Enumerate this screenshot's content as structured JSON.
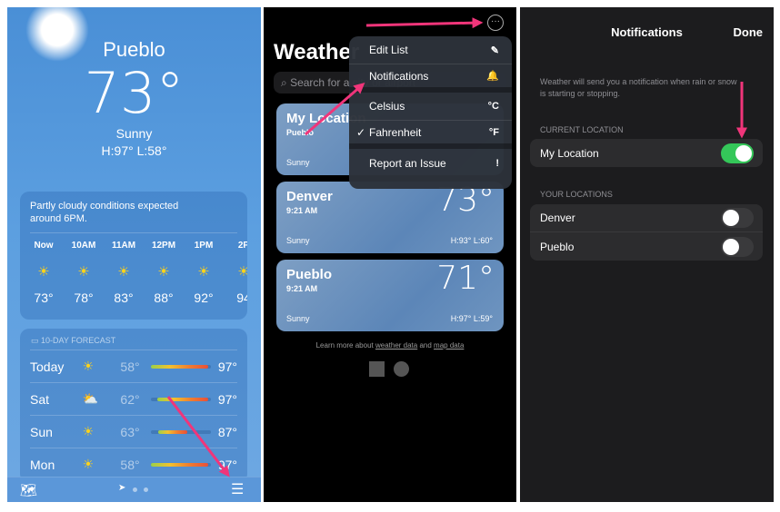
{
  "panel1": {
    "city": "Pueblo",
    "temp": "73°",
    "condition": "Sunny",
    "hilo": "H:97° L:58°",
    "summary": "Partly cloudy conditions expected around 6PM.",
    "hourly": [
      {
        "time": "Now",
        "temp": "73°"
      },
      {
        "time": "10AM",
        "temp": "78°"
      },
      {
        "time": "11AM",
        "temp": "83°"
      },
      {
        "time": "12PM",
        "temp": "88°"
      },
      {
        "time": "1PM",
        "temp": "92°"
      },
      {
        "time": "2P",
        "temp": "94"
      }
    ],
    "forecast_title": "10-DAY FORECAST",
    "days": [
      {
        "day": "Today",
        "icon": "sun",
        "low": "58°",
        "high": "97°"
      },
      {
        "day": "Sat",
        "icon": "partly-cloudy",
        "low": "62°",
        "high": "97°"
      },
      {
        "day": "Sun",
        "icon": "sun",
        "low": "63°",
        "high": "87°"
      },
      {
        "day": "Mon",
        "icon": "sun",
        "low": "58°",
        "high": "97°"
      }
    ]
  },
  "panel2": {
    "title": "Weather",
    "search_placeholder": "Search for a city or airport",
    "menu": [
      {
        "label": "Edit List",
        "icon": "✎"
      },
      {
        "label": "Notifications",
        "icon": "🔔"
      },
      {
        "label": "Celsius",
        "icon": "°C"
      },
      {
        "label": "Fahrenheit",
        "icon": "°F",
        "checked": "✓"
      },
      {
        "label": "Report an Issue",
        "icon": "!"
      }
    ],
    "locations": [
      {
        "name": "My Location",
        "sub": "Pueblo",
        "cond": "Sunny",
        "temp": "",
        "hilo": ""
      },
      {
        "name": "Denver",
        "sub": "9:21 AM",
        "cond": "Sunny",
        "temp": "73°",
        "hilo": "H:93° L:60°"
      },
      {
        "name": "Pueblo",
        "sub": "9:21 AM",
        "cond": "Sunny",
        "temp": "71°",
        "hilo": "H:97° L:59°"
      }
    ],
    "footer_pre": "Learn more about ",
    "footer_link1": "weather data",
    "footer_mid": " and ",
    "footer_link2": "map data",
    "twc_logo": "The Weather Channel"
  },
  "panel3": {
    "title": "Notifications",
    "done": "Done",
    "description": "Weather will send you a notification when rain or snow is starting or stopping.",
    "current_header": "CURRENT LOCATION",
    "current": {
      "name": "My Location",
      "on": true
    },
    "your_header": "YOUR LOCATIONS",
    "locations": [
      {
        "name": "Denver",
        "on": false
      },
      {
        "name": "Pueblo",
        "on": false
      }
    ]
  },
  "colors": {
    "arrow": "#f0357a",
    "toggle_on": "#34c759"
  }
}
